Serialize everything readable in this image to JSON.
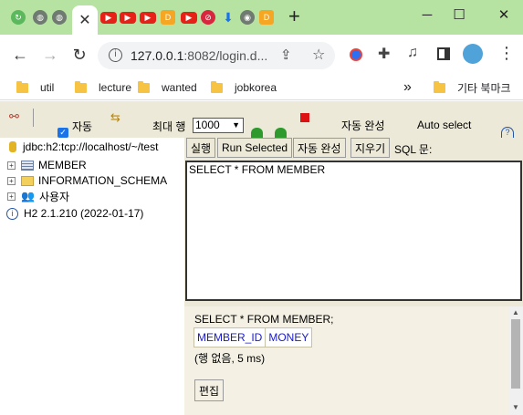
{
  "browser": {
    "url_host": "127.0.0.1",
    "url_rest": ":8082/login.d...",
    "new_tab_label": "+",
    "tab_icons": [
      "tab-icon-green",
      "tab-icon-globe",
      "tab-icon-globe",
      "youtube-icon",
      "youtube-icon",
      "youtube-icon",
      "d-icon",
      "youtube-icon",
      "basketball-icon",
      "download-icon",
      "chrome-icon",
      "d-icon"
    ],
    "bookmarks": [
      "util",
      "lecture",
      "wanted",
      "jobkorea"
    ],
    "bookmarks_more": "»",
    "other_bookmarks": "기타 북마크"
  },
  "colors": {
    "tab_bar": "#b6e3a1",
    "h2_background": "#ece9d8",
    "sql_border": "#333333",
    "column_text": "#1a1ac8"
  },
  "toolbar": {
    "autocommit_label": "자동",
    "autocommit_checked": true,
    "max_rows_label": "최대 행",
    "max_rows_value": "1000",
    "autocomplete_label": "자동 완성",
    "autoselect_label": "Auto select"
  },
  "tree": {
    "connection": "jdbc:h2:tcp://localhost/~/test",
    "items": [
      {
        "label": "MEMBER",
        "icon": "table-icon"
      },
      {
        "label": "INFORMATION_SCHEMA",
        "icon": "folder-icon"
      },
      {
        "label": "사용자",
        "icon": "users-icon"
      }
    ],
    "version": "H2 2.1.210 (2022-01-17)"
  },
  "query_bar": {
    "run": "실행",
    "run_selected": "Run Selected",
    "autocomplete": "자동 완성",
    "clear": "지우기",
    "sql_label": "SQL 문:"
  },
  "editor": {
    "sql": "SELECT * FROM MEMBER"
  },
  "result": {
    "statement": "SELECT * FROM MEMBER;",
    "columns": [
      "MEMBER_ID",
      "MONEY"
    ],
    "summary": "(행 없음, 5 ms)",
    "edit_button": "편집"
  }
}
